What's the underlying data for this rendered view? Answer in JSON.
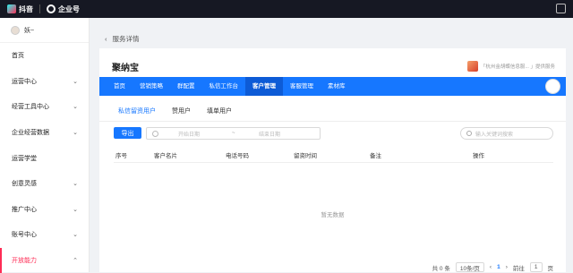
{
  "topbar": {
    "brand1": "抖音",
    "brand2": "企业号"
  },
  "sidebar": {
    "user": "妖~",
    "items": [
      {
        "label": "首页",
        "chev": ""
      },
      {
        "label": "运营中心",
        "chev": "⌄"
      },
      {
        "label": "经营工具中心",
        "chev": "⌄"
      },
      {
        "label": "企业经营数据",
        "chev": "⌄"
      },
      {
        "label": "运营学堂",
        "chev": ""
      },
      {
        "label": "创意灵感",
        "chev": "⌄"
      },
      {
        "label": "推广中心",
        "chev": "⌄"
      },
      {
        "label": "账号中心",
        "chev": "⌄"
      },
      {
        "label": "开放能力",
        "chev": "⌃"
      }
    ]
  },
  "breadcrumb": {
    "back": "‹",
    "label": "服务详情"
  },
  "card": {
    "title": "聚纳宝",
    "partner": "「杭州金胡蝶信息服... 」提供服务",
    "tabs": [
      "首页",
      "营销策略",
      "群配置",
      "私信工作台",
      "客户管理",
      "客服管理",
      "素材库"
    ],
    "subtabs": [
      "私信留资用户",
      "赞用户",
      "填单用户"
    ],
    "export": "导出",
    "date_start": "开始日期",
    "date_sep": "~",
    "date_end": "结束日期",
    "search_placeholder": "输入关键词搜索",
    "columns": [
      "序号",
      "客户名片",
      "电话号码",
      "留资时间",
      "备注",
      "操作"
    ],
    "empty": "暂无数据",
    "pager": {
      "total": "共 0 条",
      "size": "10条/页",
      "prev": "‹",
      "page": "1",
      "next": "›",
      "goto": "前往",
      "goto_value": "1",
      "goto_suffix": "页"
    }
  }
}
